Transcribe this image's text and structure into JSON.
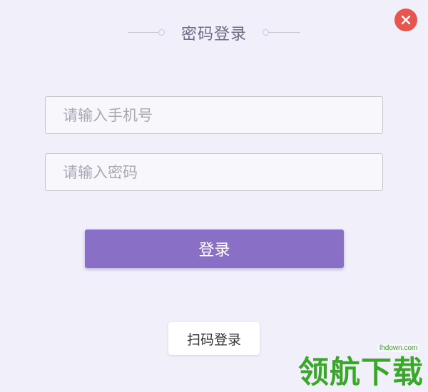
{
  "dialog": {
    "title": "密码登录",
    "close_icon": "close-icon",
    "colors": {
      "accent": "#8a6fc6",
      "close": "#e8554e",
      "background": "#f0effa"
    }
  },
  "form": {
    "phone_placeholder": "请输入手机号",
    "password_placeholder": "请输入密码",
    "login_label": "登录",
    "scan_login_label": "扫码登录"
  },
  "watermark": {
    "url": "lhdown.com",
    "text": "领航下载"
  }
}
